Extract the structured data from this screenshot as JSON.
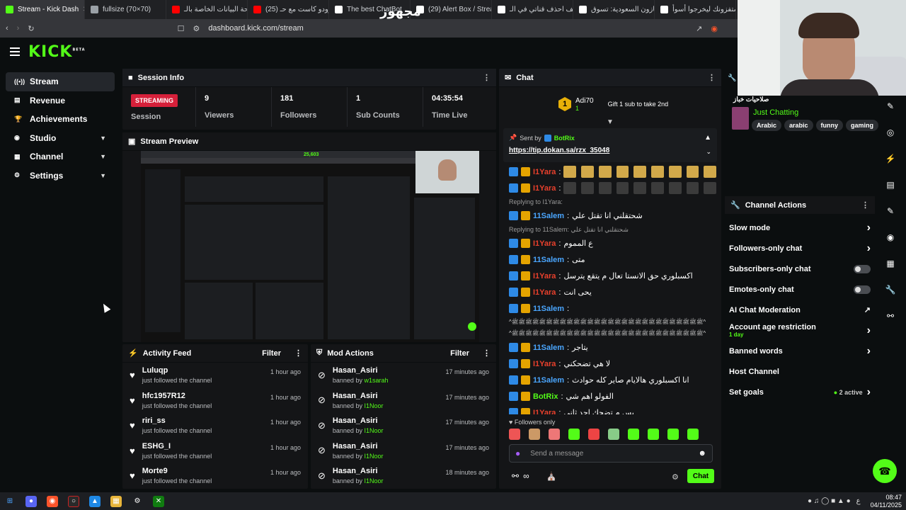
{
  "browser": {
    "tabs": [
      {
        "label": "Stream - Kick Dash",
        "active": true,
        "color": "#53fc18"
      },
      {
        "label": "fullsize (70×70)",
        "color": "#9aa0a6"
      },
      {
        "label": "لوحة البيانات الخاصة بالـ",
        "color": "#ff0000"
      },
      {
        "label": "(25) برودو كاست مع حـ",
        "color": "#ff0000"
      },
      {
        "label": "The best ChatBot",
        "color": "#ffffff"
      },
      {
        "label": "(29) Alert Box / Stream",
        "color": "#ffffff"
      },
      {
        "label": "كيف احذف قناتي في الـ",
        "color": "#ffffff"
      },
      {
        "label": "أمازون السعودية: تسوق",
        "color": "#ffffff"
      },
      {
        "label": "يستفزونك ليخرجوا أسوأ",
        "color": "#ffffff"
      }
    ],
    "overlay_text": "مجهوز",
    "url": "dashboard.kick.com/stream"
  },
  "brand": {
    "logo": "KICK",
    "logo_sup": "BETA",
    "accent": "#53fc18"
  },
  "sidebar": {
    "items": [
      {
        "label": "Stream",
        "icon": "broadcast-icon",
        "glyph": "((•))"
      },
      {
        "label": "Revenue",
        "icon": "revenue-icon",
        "glyph": "▤"
      },
      {
        "label": "Achievements",
        "icon": "trophy-icon",
        "glyph": "🏆"
      },
      {
        "label": "Studio",
        "icon": "studio-icon",
        "glyph": "◉"
      },
      {
        "label": "Channel",
        "icon": "channel-icon",
        "glyph": "▦"
      },
      {
        "label": "Settings",
        "icon": "gear-icon",
        "glyph": "⚙"
      }
    ]
  },
  "session": {
    "title": "Session Info",
    "status": "STREAMING",
    "session_label": "Session",
    "stats": [
      {
        "value": "9",
        "label": "Viewers"
      },
      {
        "value": "181",
        "label": "Followers"
      },
      {
        "value": "1",
        "label": "Sub Counts"
      },
      {
        "value": "04:35:54",
        "label": "Time Live"
      }
    ]
  },
  "preview": {
    "title": "Stream Preview",
    "overlay_number": "25,603"
  },
  "activity": {
    "title": "Activity Feed",
    "filter": "Filter",
    "items": [
      {
        "name": "Luluqp",
        "action": "just followed the channel",
        "time": "1 hour ago"
      },
      {
        "name": "hfc1957R12",
        "action": "just followed the channel",
        "time": "1 hour ago"
      },
      {
        "name": "riri_ss",
        "action": "just followed the channel",
        "time": "1 hour ago"
      },
      {
        "name": "ESHG_I",
        "action": "just followed the channel",
        "time": "1 hour ago"
      },
      {
        "name": "Morte9",
        "action": "just followed the channel",
        "time": "1 hour ago"
      }
    ]
  },
  "mod": {
    "title": "Mod Actions",
    "filter": "Filter",
    "items": [
      {
        "name": "Hasan_Asiri",
        "action": "banned by",
        "by": "w1sarah",
        "time": "17 minutes ago"
      },
      {
        "name": "Hasan_Asiri",
        "action": "banned by",
        "by": "I1Noor",
        "time": "17 minutes ago"
      },
      {
        "name": "Hasan_Asiri",
        "action": "banned by",
        "by": "I1Noor",
        "time": "17 minutes ago"
      },
      {
        "name": "Hasan_Asiri",
        "action": "banned by",
        "by": "I1Noor",
        "time": "17 minutes ago"
      },
      {
        "name": "Hasan_Asiri",
        "action": "banned by",
        "by": "I1Noor",
        "time": "18 minutes ago"
      }
    ]
  },
  "chat": {
    "title": "Chat",
    "top_gifter": {
      "rank": "1",
      "name": "Adi70",
      "count": "1"
    },
    "gift_prompt": "Gift 1 sub to take 2nd",
    "pinned": {
      "sent_by": "Sent by",
      "author": "BotRix",
      "link": "https://tip.dokan.sa/rzx_35048"
    },
    "messages": [
      {
        "user": "I1Yara",
        "color": "u1",
        "text": "",
        "emotes": 9,
        "dark": false
      },
      {
        "user": "I1Yara",
        "color": "u1",
        "text": "",
        "emotes": 9,
        "dark": true
      },
      {
        "reply": "Replying to I1Yara:"
      },
      {
        "user": "11Salem",
        "color": "u2",
        "text": "شحتقلني انا تقتل علي"
      },
      {
        "reply": "Replying to 11Salem: شحتقلني انا تقتل علي"
      },
      {
        "user": "I1Yara",
        "color": "u1",
        "text": "ع المموم"
      },
      {
        "user": "11Salem",
        "color": "u2",
        "text": "متى"
      },
      {
        "user": "I1Yara",
        "color": "u1",
        "text": "اكسبلوري حق الانستا تعال م يتقع يترسل"
      },
      {
        "user": "I1Yara",
        "color": "u1",
        "text": "يحى انت"
      },
      {
        "user": "11Salem",
        "color": "u2",
        "text": ""
      },
      {
        "line": "^ﷺﷺﷺﷺﷺﷺﷺﷺﷺﷺﷺﷺﷺﷺﷺﷺﷺﷺﷺﷺﷺﷺﷺﷺﷺﷺﷺﷺ^"
      },
      {
        "line": "^ﷺﷺﷺﷺﷺﷺﷺﷺﷺﷺﷺﷺﷺﷺﷺﷺﷺﷺﷺﷺﷺﷺﷺﷺﷺﷺﷺﷺ^"
      },
      {
        "user": "11Salem",
        "color": "u2",
        "text": "يتاجر"
      },
      {
        "user": "I1Yara",
        "color": "u1",
        "text": "لا هي تضحكني"
      },
      {
        "user": "11Salem",
        "color": "u2",
        "text": "انا اكسبلوري هالايام صاير كله حوادث"
      },
      {
        "user": "BotRix",
        "color": "u3",
        "text": "الفولو اهم شي"
      },
      {
        "user": "I1Yara",
        "color": "u1",
        "text": "بس م تضحك احد ثاني"
      }
    ],
    "followers_only": "Followers only",
    "input_placeholder": "Send a message",
    "send_label": "Chat"
  },
  "channel": {
    "title_ar": "صلاحيات خباز",
    "category": "Just Chatting",
    "tags": [
      "Arabic",
      "arabic",
      "funny",
      "gaming"
    ]
  },
  "actions": {
    "title": "Channel Actions",
    "items": [
      {
        "label": "Slow mode",
        "kind": "chevron"
      },
      {
        "label": "Followers-only chat",
        "kind": "chevron"
      },
      {
        "label": "Subscribers-only chat",
        "kind": "toggle"
      },
      {
        "label": "Emotes-only chat",
        "kind": "toggle"
      },
      {
        "label": "AI Chat Moderation",
        "kind": "external"
      },
      {
        "label": "Account age restriction",
        "kind": "chevron",
        "sub": "1 day"
      },
      {
        "label": "Banned words",
        "kind": "chevron"
      },
      {
        "label": "Host Channel",
        "kind": "none"
      },
      {
        "label": "Set goals",
        "kind": "chevron",
        "status": "2 active"
      }
    ]
  },
  "taskbar": {
    "time": "08:47",
    "date": "04/11/2025",
    "lang": "ع"
  }
}
